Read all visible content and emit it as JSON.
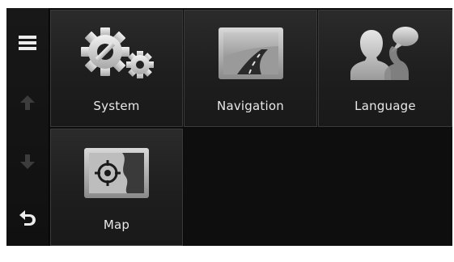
{
  "sidebar": {
    "menu_icon": "hamburger-menu-icon",
    "up_icon": "arrow-up-icon",
    "down_icon": "arrow-down-icon",
    "back_icon": "back-arrow-icon"
  },
  "tiles": [
    {
      "label": "System",
      "icon": "gears-icon"
    },
    {
      "label": "Navigation",
      "icon": "road-icon"
    },
    {
      "label": "Language",
      "icon": "people-speech-icon"
    },
    {
      "label": "Map",
      "icon": "map-crosshair-icon"
    }
  ],
  "colors": {
    "background": "#0c0c0c",
    "tile": "#222222",
    "text": "#e8e8e8",
    "disabled_arrow": "#3c3c3c"
  }
}
